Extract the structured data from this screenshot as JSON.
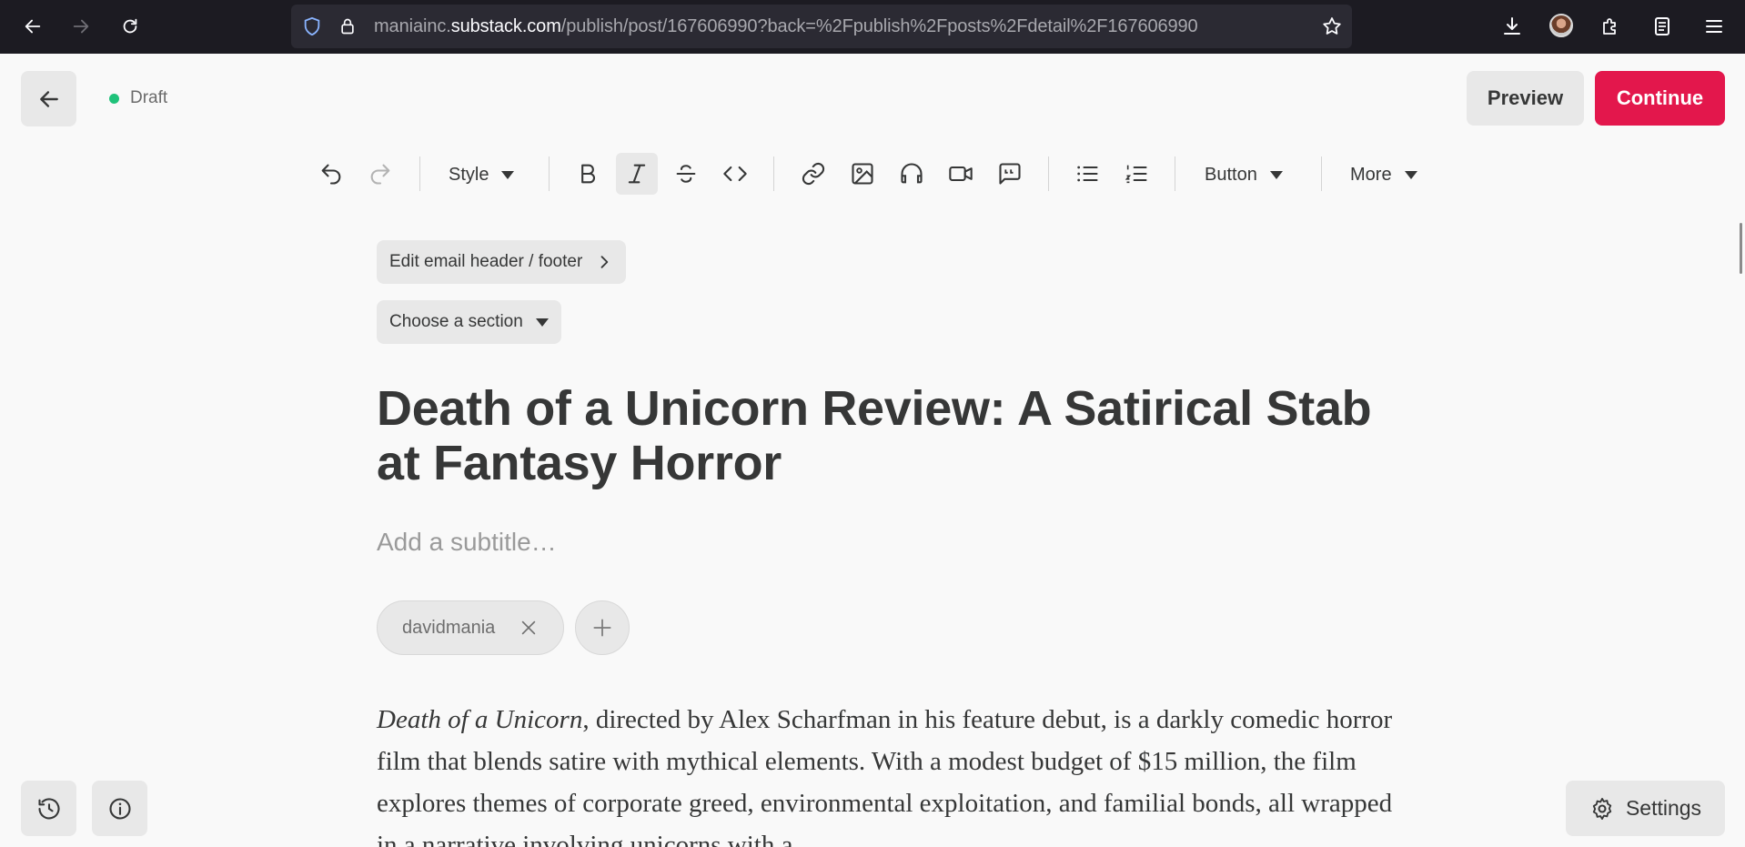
{
  "browser": {
    "url_prefix": "maniainc.",
    "url_domain": "substack.com",
    "url_path": "/publish/post/167606990?back=%2Fpublish%2Fposts%2Fdetail%2F167606990"
  },
  "editor": {
    "status": "Draft",
    "status_color": "#1fc27a",
    "preview_label": "Preview",
    "continue_label": "Continue",
    "accent_color": "#e3174c"
  },
  "toolbar": {
    "style_label": "Style",
    "button_label": "Button",
    "more_label": "More",
    "active_tool": "italic"
  },
  "post": {
    "email_header_label": "Edit email header / footer",
    "section_label": "Choose a section",
    "title": "Death of a Unicorn Review: A Satirical Stab at Fantasy Horror",
    "subtitle_placeholder": "Add a subtitle…",
    "author": "davidmania",
    "body_italic": "Death of a Unicorn",
    "body_rest": ", directed by Alex Scharfman in his feature debut, is a darkly comedic horror film that blends satire with mythical elements. With a modest budget of $15 million, the film explores themes of corporate greed, environmental exploitation, and familial bonds, all wrapped in a narrative involving unicorns with a"
  },
  "footer": {
    "settings_label": "Settings"
  }
}
